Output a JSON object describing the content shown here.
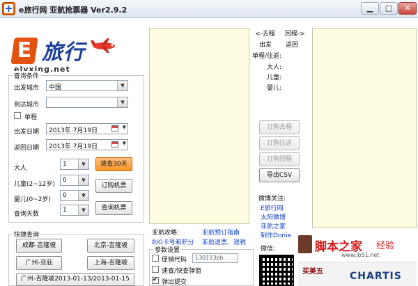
{
  "window": {
    "title": "e旅行网 亚航抢票器 Ver2.9.2",
    "minimize": "▁",
    "maximize": "□",
    "close": "✕"
  },
  "logo": {
    "mark": "E",
    "cn": "旅行",
    "en": "elvxing.net"
  },
  "query": {
    "group_label": "查询条件",
    "from_label": "出发城市",
    "from_value": "中国",
    "to_label": "到达城市",
    "to_value": "",
    "oneway_label": "单程",
    "oneway_checked": false,
    "depart_label": "出发日期",
    "depart_value": "2013年 7月19日",
    "return_label": "返回日期",
    "return_value": "2013年 7月19日",
    "adult_label": "大人",
    "adult_value": "1",
    "child_label": "儿童(2~12岁)",
    "child_value": "0",
    "infant_label": "婴儿(0~2岁)",
    "infant_value": "0",
    "days_label": "查询天数",
    "days_value": "1",
    "btn_30days": "速查30天",
    "btn_order": "订购机票",
    "btn_query": "查询机票"
  },
  "quick": {
    "group_label": "快捷查询",
    "items": [
      "成都-吉隆坡",
      "北京-吉隆坡",
      "广州-亚庇",
      "上海-吉隆坡",
      "广州-吉隆坡2013-01-13/2013-01-15"
    ]
  },
  "middle": {
    "arrow_go": "<-去程",
    "arrow_back": "回程->",
    "depart": "出发",
    "return": "返回",
    "trip_type": "单程/往返:",
    "adult": "大人:",
    "child": "儿童:",
    "infant": "婴儿:",
    "btn_order_go": "订购去程",
    "btn_order_round": "订购往返",
    "btn_order_back": "订购回程",
    "btn_export": "导出CSV"
  },
  "weibo": {
    "title": "微博关注:",
    "links": [
      "E旅行网",
      "太阳微博",
      "亚航之家",
      "制作Donie"
    ],
    "wechat": "微信:"
  },
  "guide": {
    "title": "亚航攻略:",
    "link1": "亚航预订指南",
    "link2": "BIG卡号和积分",
    "link3": "亚航退票、退税"
  },
  "params": {
    "group_label": "参数设置",
    "promo_label": "促销代码",
    "promo_value": "130113pb",
    "quick_popup_label": "速查/快查弹窗",
    "opt3_label": "弹出提交",
    "opt3_checked": true
  },
  "ads": {
    "watermark": "脚本之家",
    "watermark_sub": "www.jb51.net",
    "ad_text": "买美五",
    "ad_brand": "CHARTIS",
    "ad_badge": "经验"
  },
  "colors": {
    "accent": "#ff9426",
    "pane": "#fefde1",
    "link": "#1242c8",
    "logo_orange": "#e4520f",
    "logo_blue": "#1e3f99"
  }
}
